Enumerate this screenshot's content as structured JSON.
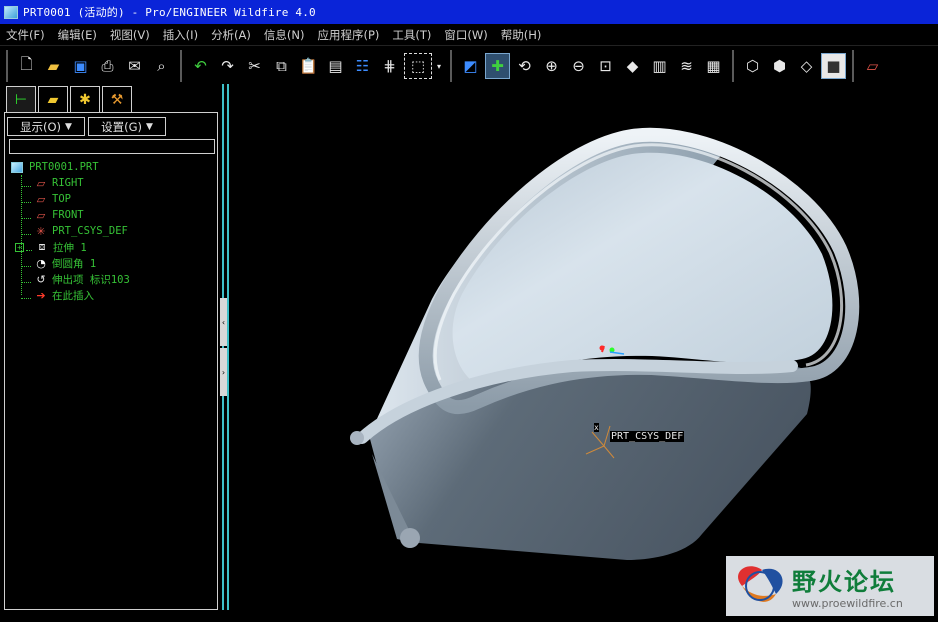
{
  "window": {
    "title": "PRT0001 (活动的) - Pro/ENGINEER Wildfire 4.0"
  },
  "menu": [
    {
      "label": "文件(F)"
    },
    {
      "label": "编辑(E)"
    },
    {
      "label": "视图(V)"
    },
    {
      "label": "插入(I)"
    },
    {
      "label": "分析(A)"
    },
    {
      "label": "信息(N)"
    },
    {
      "label": "应用程序(P)"
    },
    {
      "label": "工具(T)"
    },
    {
      "label": "窗口(W)"
    },
    {
      "label": "帮助(H)"
    }
  ],
  "toolbar": {
    "file_tools": [
      "new-file-icon",
      "open-folder-icon",
      "save-icon",
      "print-icon",
      "email-icon",
      "find-file-icon"
    ],
    "edit_tools": [
      "undo-icon",
      "redo-icon",
      "cut-icon",
      "copy-icon",
      "paste-icon",
      "paste-special-icon",
      "regenerate-icon",
      "regen-manager-icon",
      "selection-filter-icon"
    ],
    "view_tools": [
      "repaint-icon",
      "spin-center-icon",
      "orient-mode-icon",
      "zoom-in-icon",
      "zoom-out-icon",
      "refit-icon",
      "reorient-icon",
      "saved-views-icon",
      "layers-icon",
      "view-manager-icon"
    ],
    "display_tools": [
      "wireframe-icon",
      "hidden-line-icon",
      "no-hidden-icon",
      "shading-icon"
    ],
    "datum_tools": [
      "datum-plane-display-icon"
    ]
  },
  "model_tree": {
    "tabs": [
      "model-tree-tab",
      "folder-browser-tab",
      "favorites-tab",
      "connections-tab"
    ],
    "display_dropdown": "显示(O)",
    "settings_dropdown": "设置(G)",
    "search_value": "",
    "items": [
      {
        "label": "PRT0001.PRT",
        "icon": "part-icon"
      },
      {
        "label": "RIGHT",
        "icon": "datum-plane-icon"
      },
      {
        "label": "TOP",
        "icon": "datum-plane-icon"
      },
      {
        "label": "FRONT",
        "icon": "datum-plane-icon"
      },
      {
        "label": "PRT_CSYS_DEF",
        "icon": "coordinate-system-icon"
      },
      {
        "label": "拉伸 1",
        "icon": "extrude-icon"
      },
      {
        "label": "倒圆角 1",
        "icon": "round-icon"
      },
      {
        "label": "伸出项 标识103",
        "icon": "sweep-protrusion-icon"
      },
      {
        "label": "在此插入",
        "icon": "insert-here-icon"
      }
    ]
  },
  "graphics": {
    "csys_label": "PRT_CSYS_DEF",
    "csys_axis_x": "x"
  },
  "watermark": {
    "brand": "野火论坛",
    "url": "www.proewildfire.cn"
  },
  "colors": {
    "title_bar": "#0a24d8",
    "tree_text": "#36c236",
    "splitter": "#3ec0c8",
    "model_body": "#5d6b78",
    "model_top": "#c9d6e0"
  }
}
